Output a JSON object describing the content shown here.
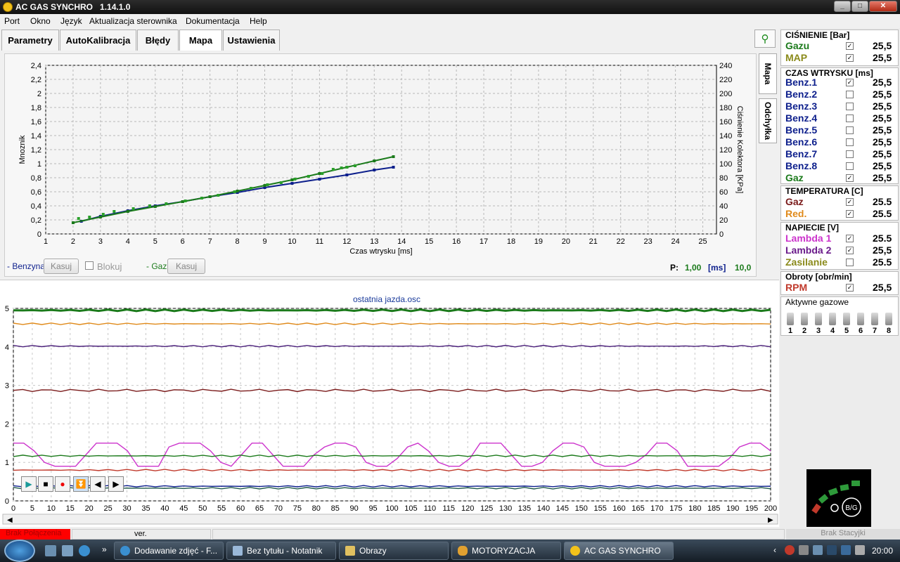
{
  "app": {
    "title": "AC GAS SYNCHRO",
    "version": "1.14.1.0"
  },
  "menu": [
    "Port",
    "Okno",
    "Język",
    "Aktualizacja sterownika",
    "Dokumentacja",
    "Help"
  ],
  "tabs": [
    "Parametry",
    "AutoKalibracja",
    "Błędy",
    "Mapa",
    "Ustawienia"
  ],
  "active_tab": "Mapa",
  "side_tabs": [
    "Mapa",
    "Odchyłka"
  ],
  "map": {
    "controls": {
      "benzyna_label": "- Benzyna",
      "kasuj1": "Kasuj",
      "blokuj": "Blokuj",
      "gaz_label": "- Gaz",
      "kasuj2": "Kasuj",
      "p_label": "P:",
      "p_value": "1,00",
      "p_unit": "[ms]",
      "p_value2": "10,0"
    }
  },
  "scope": {
    "title": "ostatnia jazda.osc"
  },
  "chart_data": [
    {
      "type": "scatter",
      "xlabel": "Czas wtrysku [ms]",
      "ylabel": "Mnoznik",
      "y2label": "Ciśnienie Kolektora [KPa]",
      "xlim": [
        1,
        25.5
      ],
      "ylim": [
        0,
        2.4
      ],
      "y2lim": [
        0,
        240
      ],
      "xticks": [
        "1",
        "2",
        "3",
        "4",
        "5",
        "6",
        "7",
        "8",
        "9",
        "10",
        "11",
        "12",
        "13",
        "14",
        "15",
        "16",
        "17",
        "18",
        "19",
        "20",
        "21",
        "22",
        "23",
        "24",
        "25"
      ],
      "yticks": [
        "0",
        "0,2",
        "0,4",
        "0,6",
        "0,8",
        "1",
        "1,2",
        "1,4",
        "1,6",
        "1,8",
        "2",
        "2,2",
        "2,4"
      ],
      "y2ticks": [
        "0",
        "20",
        "40",
        "60",
        "80",
        "100",
        "120",
        "140",
        "160",
        "180",
        "200",
        "220",
        "240"
      ],
      "grid": true,
      "series": [
        {
          "name": "Benzyna",
          "color": "#0d1f8c",
          "x": [
            2.3,
            3,
            4,
            5,
            6,
            7,
            8,
            9,
            10,
            11,
            12,
            13,
            13.7
          ],
          "y": [
            0.18,
            0.25,
            0.33,
            0.4,
            0.46,
            0.53,
            0.59,
            0.66,
            0.72,
            0.78,
            0.84,
            0.91,
            0.95
          ]
        },
        {
          "name": "Gaz",
          "color": "#1b7a1b",
          "x": [
            2,
            3,
            4,
            5,
            6,
            7,
            8,
            9,
            10,
            11,
            12,
            13,
            13.7
          ],
          "y": [
            0.16,
            0.24,
            0.32,
            0.39,
            0.46,
            0.53,
            0.61,
            0.69,
            0.77,
            0.86,
            0.95,
            1.04,
            1.1
          ]
        },
        {
          "name": "Gaz punkty",
          "color": "#2aa02a",
          "x": [
            2.2,
            2.6,
            3.1,
            3.5,
            4.2,
            4.8,
            5.4,
            6.1,
            6.7,
            7.3,
            7.9,
            8.5,
            9.1,
            9.6,
            10.1,
            10.6,
            11.1,
            11.5,
            11.8,
            12.0,
            12.3
          ],
          "y": [
            0.22,
            0.24,
            0.28,
            0.32,
            0.36,
            0.4,
            0.43,
            0.47,
            0.51,
            0.55,
            0.6,
            0.65,
            0.7,
            0.73,
            0.78,
            0.82,
            0.86,
            0.92,
            0.94,
            0.95,
            0.97
          ]
        }
      ]
    },
    {
      "type": "line",
      "xlim": [
        0,
        200
      ],
      "ylim": [
        0,
        5
      ],
      "xticks": [
        "0",
        "5",
        "10",
        "15",
        "20",
        "25",
        "30",
        "35",
        "40",
        "45",
        "50",
        "55",
        "60",
        "65",
        "70",
        "75",
        "80",
        "85",
        "90",
        "95",
        "100",
        "105",
        "110",
        "115",
        "120",
        "125",
        "130",
        "135",
        "140",
        "145",
        "150",
        "155",
        "160",
        "165",
        "170",
        "175",
        "180",
        "185",
        "190",
        "195",
        "200"
      ],
      "yticks": [
        "0",
        "1",
        "2",
        "3",
        "4",
        "5"
      ],
      "grid": true,
      "series": [
        {
          "color": "#1b7a1b",
          "level": 4.95
        },
        {
          "color": "#e08a1a",
          "level": 4.6
        },
        {
          "color": "#4a1f7a",
          "level": 4.02
        },
        {
          "color": "#7a1a1a",
          "level": 2.87
        },
        {
          "color": "#cc33cc",
          "pattern": [
            1.5,
            1.5,
            1.3,
            1.0,
            0.9,
            0.9,
            0.9,
            1.2,
            1.5,
            1.5,
            1.5,
            1.3,
            0.9,
            0.9,
            0.9,
            1.4,
            1.5,
            1.5,
            1.5,
            1.3,
            1.0,
            0.9,
            1.2,
            1.5,
            1.5,
            1.2,
            0.9,
            0.9,
            0.9,
            1.2,
            1.4,
            1.5,
            1.5,
            1.4,
            1.0,
            0.9,
            0.9,
            1.1,
            1.4,
            1.5,
            1.3,
            1.0,
            0.9,
            0.9,
            1.1,
            1.5,
            1.5,
            1.5,
            1.2,
            0.9,
            0.9,
            1.0,
            1.3,
            1.5,
            1.5,
            1.4,
            1.0,
            0.9,
            0.9,
            0.9,
            1.0,
            1.2,
            1.5,
            1.5,
            1.3,
            0.9,
            0.9,
            0.9,
            0.9,
            1.1,
            1.4,
            1.5,
            1.5,
            1.3
          ]
        },
        {
          "color": "#1b7a1b",
          "level": 1.17
        },
        {
          "color": "#c0392b",
          "level": 0.8
        },
        {
          "color": "#0d1f8c",
          "level": 0.38
        },
        {
          "color": "#1f5a4a",
          "level": 0.33
        }
      ]
    }
  ],
  "right_panel": {
    "cisnienie": {
      "title": "CIŚNIENIE [Bar]",
      "rows": [
        {
          "label": "Gazu",
          "color": "#1b7a1b",
          "checked": true,
          "value": "25,5"
        },
        {
          "label": "MAP",
          "color": "#8a8a1a",
          "checked": true,
          "value": "25,5"
        }
      ]
    },
    "czas": {
      "title": "CZAS WTRYSKU  [ms]",
      "rows": [
        {
          "label": "Benz.1",
          "color": "#0d1f8c",
          "checked": true,
          "value": "25,5"
        },
        {
          "label": "Benz.2",
          "color": "#0d1f8c",
          "checked": false,
          "value": "25,5"
        },
        {
          "label": "Benz.3",
          "color": "#0d1f8c",
          "checked": false,
          "value": "25,5"
        },
        {
          "label": "Benz.4",
          "color": "#0d1f8c",
          "checked": false,
          "value": "25,5"
        },
        {
          "label": "Benz.5",
          "color": "#0d1f8c",
          "checked": false,
          "value": "25,5"
        },
        {
          "label": "Benz.6",
          "color": "#0d1f8c",
          "checked": false,
          "value": "25,5"
        },
        {
          "label": "Benz.7",
          "color": "#0d1f8c",
          "checked": false,
          "value": "25,5"
        },
        {
          "label": "Benz.8",
          "color": "#0d1f8c",
          "checked": false,
          "value": "25,5"
        },
        {
          "label": "Gaz",
          "color": "#1b7a1b",
          "checked": true,
          "value": "25,5"
        }
      ]
    },
    "temperatura": {
      "title": "TEMPERATURA  [C]",
      "rows": [
        {
          "label": "Gaz",
          "color": "#7a1a1a",
          "checked": true,
          "value": "25.5"
        },
        {
          "label": "Red.",
          "color": "#e08a1a",
          "checked": true,
          "value": "25.5"
        }
      ]
    },
    "napiecie": {
      "title": "NAPIECIE [V]",
      "rows": [
        {
          "label": "Lambda 1",
          "color": "#cc33cc",
          "checked": true,
          "value": "25.5"
        },
        {
          "label": "Lambda 2",
          "color": "#6a1a8a",
          "checked": true,
          "value": "25,5"
        },
        {
          "label": "Zasilanie",
          "color": "#8a8a1a",
          "checked": false,
          "value": "25.5"
        }
      ]
    },
    "obroty": {
      "title": "Obroty [obr/min]",
      "rows": [
        {
          "label": "RPM",
          "color": "#c0392b",
          "checked": true,
          "value": "25,5"
        }
      ]
    },
    "aktywne": {
      "title": "Aktywne gazowe",
      "injectors": [
        "1",
        "2",
        "3",
        "4",
        "5",
        "6",
        "7",
        "8"
      ]
    }
  },
  "logo_text": "B/G",
  "status": {
    "conn": "Brak Połączenia",
    "ver": "ver.",
    "station": "Brak Stacyjki"
  },
  "taskbar": {
    "tasks": [
      "Dodawanie zdjęć - F...",
      "Bez tytułu - Notatnik",
      "Obrazy",
      "MOTORYZACJA",
      "AC GAS SYNCHRO"
    ],
    "clock": "20:00",
    "quick_more": "»"
  },
  "colors": {
    "accent_green": "#1b7a1b",
    "accent_blue": "#0d1f8c",
    "status_red": "#ff0000"
  }
}
